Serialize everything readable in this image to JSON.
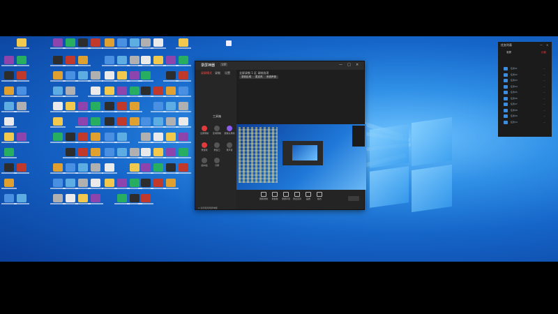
{
  "app_window": {
    "brand": "录屏神器",
    "version": "VIP",
    "controls": [
      "—",
      "□",
      "×"
    ],
    "tabs": [
      "录屏模式",
      "录制",
      "设置"
    ],
    "section_label": "工具箱",
    "tools": [
      "全屏录制",
      "区域录制",
      "摄像头录制",
      "录游戏",
      "录窗口",
      "录声音",
      "画中画",
      "分屏"
    ],
    "header_text": "全屏录制 1 区 录制选项",
    "buttons": [
      "录制区域",
      "麦克风",
      "系统声音"
    ],
    "bottom_buttons": [
      "屏幕录制",
      "录摄像",
      "录屏声音",
      "录麦克风",
      "画质",
      "格式"
    ],
    "status": "◎ 如何使用录屏神器"
  },
  "right_panel": {
    "title": "任务列表",
    "controls": [
      "—",
      "×"
    ],
    "tabs": [
      "录屏",
      "计划"
    ],
    "rows": [
      "任务01",
      "任务02",
      "任务03",
      "任务04",
      "任务05",
      "任务06",
      "任务07",
      "任务08",
      "任务09",
      "任务10"
    ]
  },
  "colors": {
    "accent": "#ff4a4a",
    "desktop": "#1565c8",
    "panel": "#1b1b1b"
  }
}
